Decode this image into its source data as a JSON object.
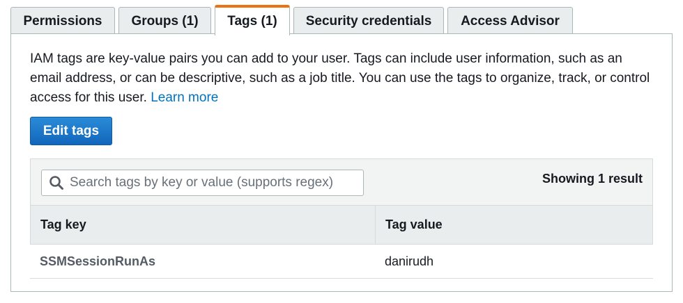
{
  "tabs": [
    {
      "label": "Permissions",
      "active": false
    },
    {
      "label": "Groups (1)",
      "active": false
    },
    {
      "label": "Tags (1)",
      "active": true
    },
    {
      "label": "Security credentials",
      "active": false
    },
    {
      "label": "Access Advisor",
      "active": false
    }
  ],
  "description": {
    "text": "IAM tags are key-value pairs you can add to your user. Tags can include user information, such as an email address, or can be descriptive, such as a job title. You can use the tags to organize, track, or  control access for this user.",
    "link_label": "Learn more"
  },
  "edit_button_label": "Edit tags",
  "search": {
    "placeholder": "Search tags by key or value (supports regex)",
    "value": "",
    "icon": "search-icon"
  },
  "result_count_text": "Showing 1 result",
  "table": {
    "columns": [
      "Tag key",
      "Tag value"
    ],
    "rows": [
      {
        "key": "SSMSessionRunAs",
        "value": "danirudh"
      }
    ]
  },
  "colors": {
    "active_tab_accent": "#ec7211",
    "link": "#0073bb",
    "primary_button": "#1166bb"
  }
}
